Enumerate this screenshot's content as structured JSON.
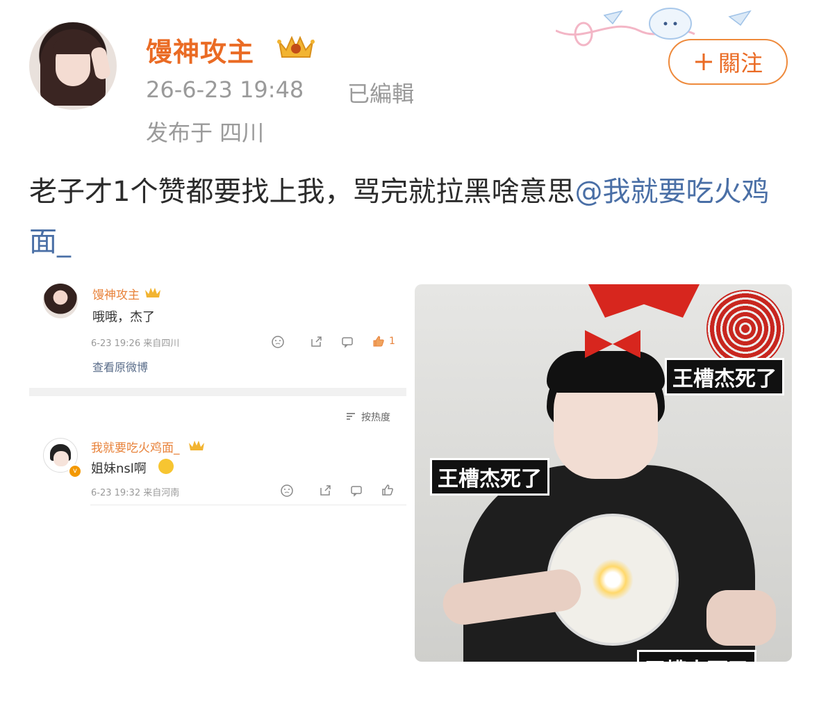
{
  "header": {
    "username": "馒神攻主",
    "timestamp": "26-6-23 19:48",
    "edited": "已編輯",
    "location": "发布于 四川",
    "follow_label": "關注"
  },
  "post": {
    "text": "老子才1个赞都要找上我，骂完就拉黑啥意思",
    "mention": "@我就要吃火鸡面_"
  },
  "screenshot": {
    "comment1": {
      "name": "馒神攻主",
      "text": "哦哦，杰了",
      "time": "6-23 19:26 来自四川",
      "like_count": "1"
    },
    "view_original": "查看原微博",
    "sort_label": "按热度",
    "comment2": {
      "name": "我就要吃火鸡面_",
      "text": "姐妹nsl啊",
      "time": "6-23 19:32 来自河南"
    }
  },
  "photo": {
    "captions": [
      "王槽杰死了",
      "王槽杰死了",
      "王槽杰死了"
    ]
  },
  "colors": {
    "username": "#ea6b24",
    "mention": "#4a6fa6",
    "follow_border": "#ee8a3c"
  }
}
